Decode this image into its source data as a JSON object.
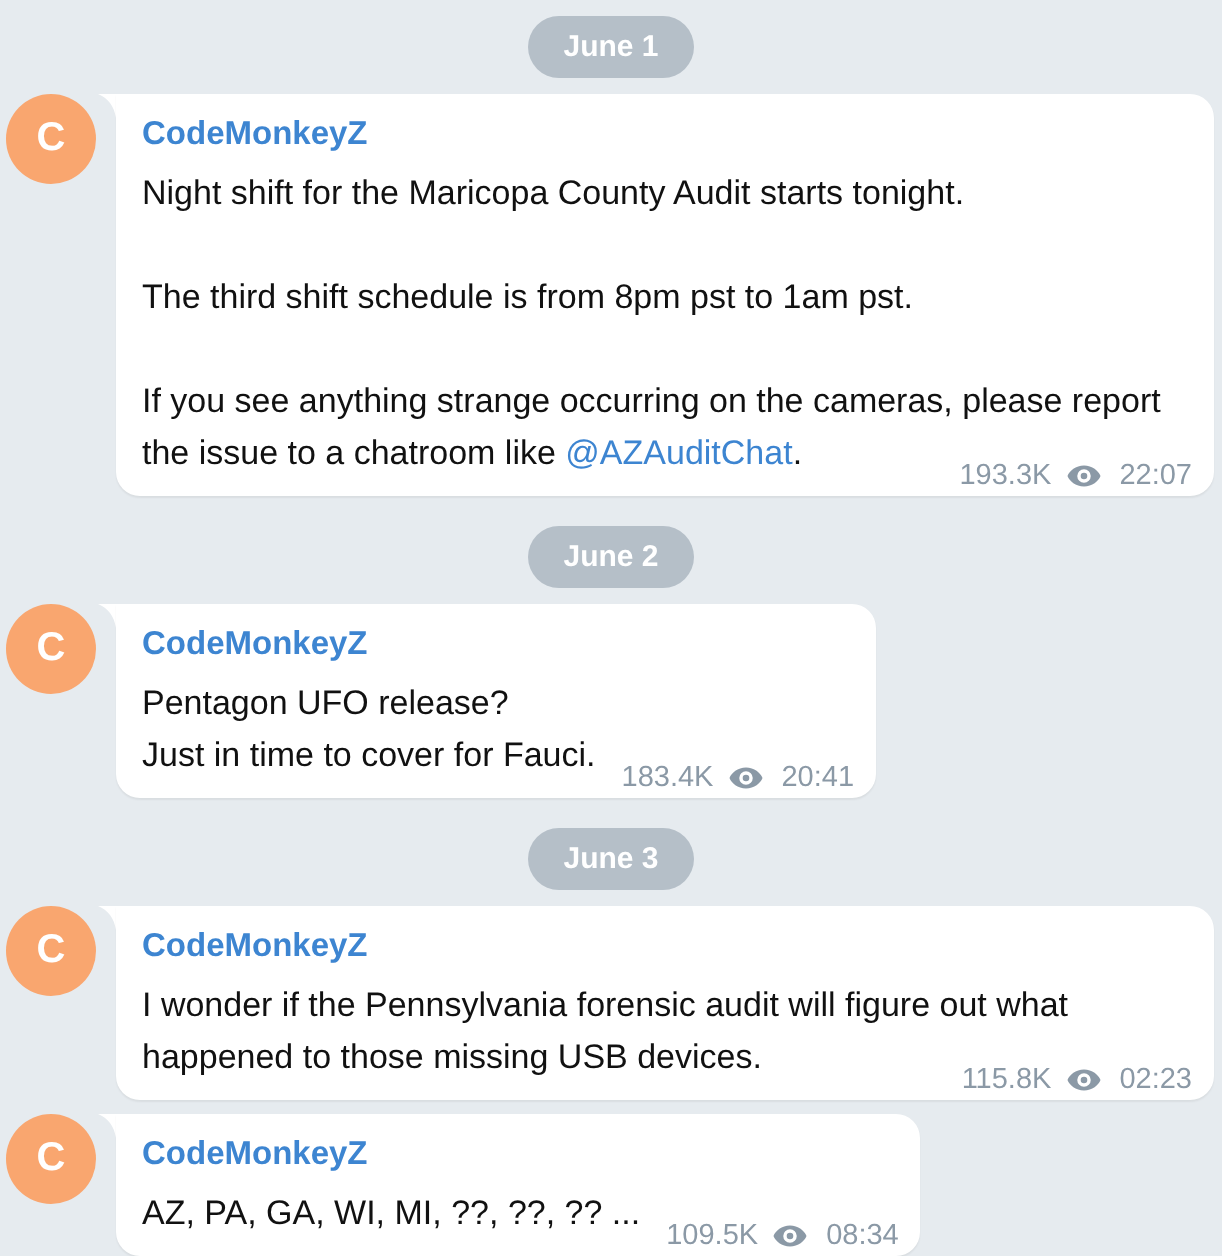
{
  "days": [
    {
      "date": "June 1",
      "messages": [
        {
          "avatar_letter": "C",
          "author": "CodeMonkeyZ",
          "body": [
            {
              "kind": "text",
              "text": "Night shift for the Maricopa County Audit starts tonight.\n\nThe third shift schedule is from 8pm pst to 1am pst.\n\nIf you see anything strange occurring on the cameras, please report the issue to a chatroom like "
            },
            {
              "kind": "link",
              "text": "@AZAuditChat"
            },
            {
              "kind": "text",
              "text": "."
            }
          ],
          "views": "193.3K",
          "time": "22:07"
        }
      ]
    },
    {
      "date": "June 2",
      "messages": [
        {
          "avatar_letter": "C",
          "author": "CodeMonkeyZ",
          "body": [
            {
              "kind": "text",
              "text": "Pentagon UFO release?\nJust in time to cover for Fauci."
            }
          ],
          "views": "183.4K",
          "time": "20:41"
        }
      ]
    },
    {
      "date": "June 3",
      "messages": [
        {
          "avatar_letter": "C",
          "author": "CodeMonkeyZ",
          "body": [
            {
              "kind": "text",
              "text": "I wonder if the Pennsylvania forensic audit will figure out what happened to those missing USB devices."
            }
          ],
          "views": "115.8K",
          "time": "02:23"
        },
        {
          "avatar_letter": "C",
          "author": "CodeMonkeyZ",
          "body": [
            {
              "kind": "text",
              "text": "AZ, PA, GA, WI, MI, ??, ??, ?? ..."
            }
          ],
          "views": "109.5K",
          "time": "08:34"
        }
      ]
    }
  ]
}
